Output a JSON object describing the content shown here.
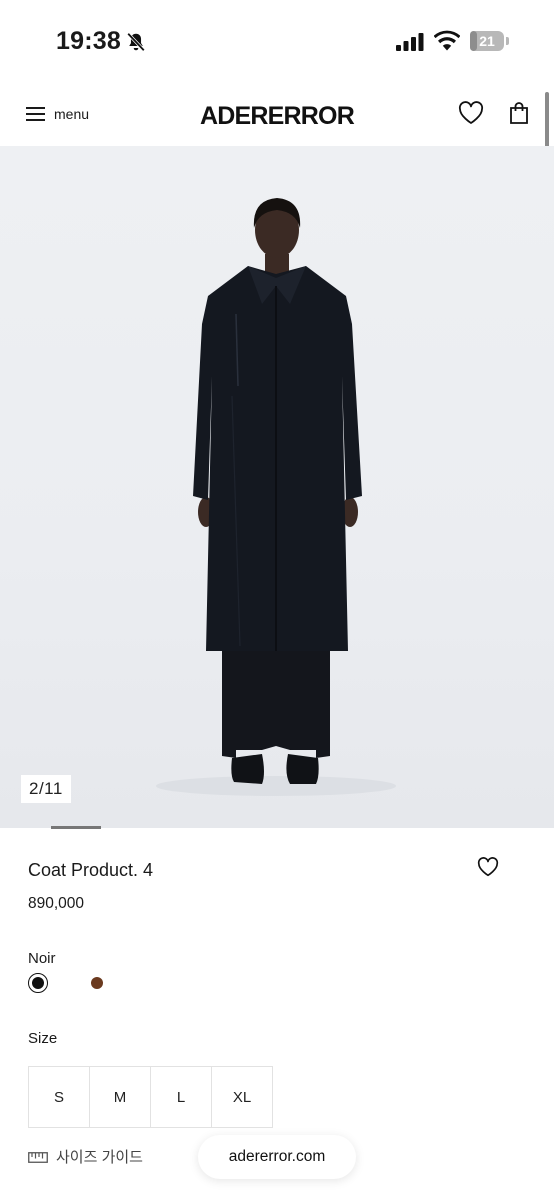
{
  "status_bar": {
    "time": "19:38",
    "battery_percent": "21",
    "battery_level": 0.21,
    "icons": [
      "bell-slash-icon",
      "cellular-signal-icon",
      "wifi-icon",
      "battery-icon"
    ]
  },
  "header": {
    "menu_label": "menu",
    "logo_text": "ADERERROR",
    "icons": [
      "hamburger-menu-icon",
      "heart-icon",
      "shopping-bag-icon"
    ]
  },
  "gallery": {
    "counter": "2/11",
    "current_index": 2,
    "total_images": 11
  },
  "product": {
    "name": "Coat Product. 4",
    "price": "890,000",
    "color_label": "Noir",
    "colors": [
      {
        "name": "Noir",
        "hex": "#111111",
        "selected": true
      },
      {
        "name": "brown",
        "hex": "#6b3a1f",
        "selected": false
      }
    ],
    "size_label": "Size",
    "sizes": [
      "S",
      "M",
      "L",
      "XL"
    ],
    "size_guide_label": "사이즈 가이드"
  },
  "browser": {
    "url": "adererror.com"
  },
  "colors": {
    "background": "#ffffff",
    "image_bg": "#eceef2",
    "text": "#1a1a1a",
    "coat": "#141820"
  }
}
